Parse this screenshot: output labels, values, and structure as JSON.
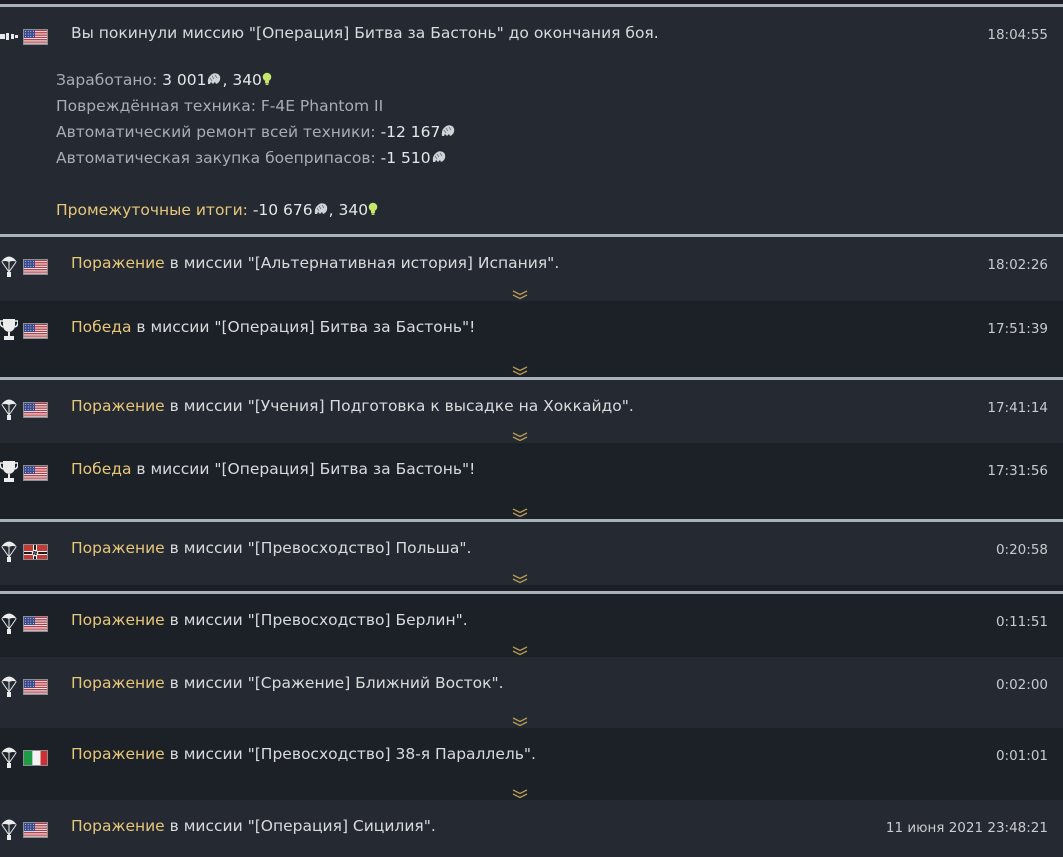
{
  "colors": {
    "result_highlight": "#e6c77a",
    "separator": "#a7b2bb",
    "row_odd": "#252a32",
    "row_even": "#1c2027",
    "research_points": "#c6e86a"
  },
  "detailed_entry": {
    "icon": "exit-icon",
    "flag": "usa",
    "message": "Вы покинули миссию \"[Операция] Битва за Бастонь\" до окончания боя.",
    "time": "18:04:55",
    "earned_label": "Заработано: ",
    "earned_silver": "3 001",
    "earned_rp": ", 340",
    "damaged_label": "Повреждённая техника: ",
    "damaged_value": "F-4E Phantom II",
    "repair_label": "Автоматический ремонт всей техники: ",
    "repair_value": "-12 167",
    "ammo_label": "Автоматическая закупка боеприпасов: ",
    "ammo_value": "-1 510",
    "subtotal_label": "Промежуточные итоги: ",
    "subtotal_silver": "-10 676",
    "subtotal_rp": ", 340"
  },
  "entries": [
    {
      "icon": "parachute-icon",
      "flag": "usa",
      "result": "Поражение",
      "message": " в миссии \"[Альтернативная история] Испания\".",
      "time": "18:02:26"
    },
    {
      "icon": "trophy-icon",
      "flag": "usa",
      "result": "Победа",
      "message": " в миссии \"[Операция] Битва за Бастонь\"!",
      "time": "17:51:39"
    },
    {
      "icon": "parachute-icon",
      "flag": "usa",
      "result": "Поражение",
      "message": " в миссии \"[Учения] Подготовка к высадке на Хоккайдо\".",
      "time": "17:41:14"
    },
    {
      "icon": "trophy-icon",
      "flag": "usa",
      "result": "Победа",
      "message": " в миссии \"[Операция] Битва за Бастонь\"!",
      "time": "17:31:56"
    },
    {
      "icon": "parachute-icon",
      "flag": "germany",
      "result": "Поражение",
      "message": " в миссии \"[Превосходство] Польша\".",
      "time": "0:20:58"
    },
    {
      "icon": "parachute-icon",
      "flag": "usa",
      "result": "Поражение",
      "message": " в миссии \"[Превосходство] Берлин\".",
      "time": "0:11:51"
    },
    {
      "icon": "parachute-icon",
      "flag": "usa",
      "result": "Поражение",
      "message": " в миссии \"[Сражение] Ближний Восток\".",
      "time": "0:02:00"
    },
    {
      "icon": "parachute-icon",
      "flag": "italy",
      "result": "Поражение",
      "message": " в миссии \"[Превосходство] 38-я Параллель\".",
      "time": "0:01:01"
    },
    {
      "icon": "parachute-icon",
      "flag": "usa",
      "result": "Поражение",
      "message": " в миссии \"[Операция] Сицилия\".",
      "time": "11 июня 2021 23:48:21"
    }
  ]
}
